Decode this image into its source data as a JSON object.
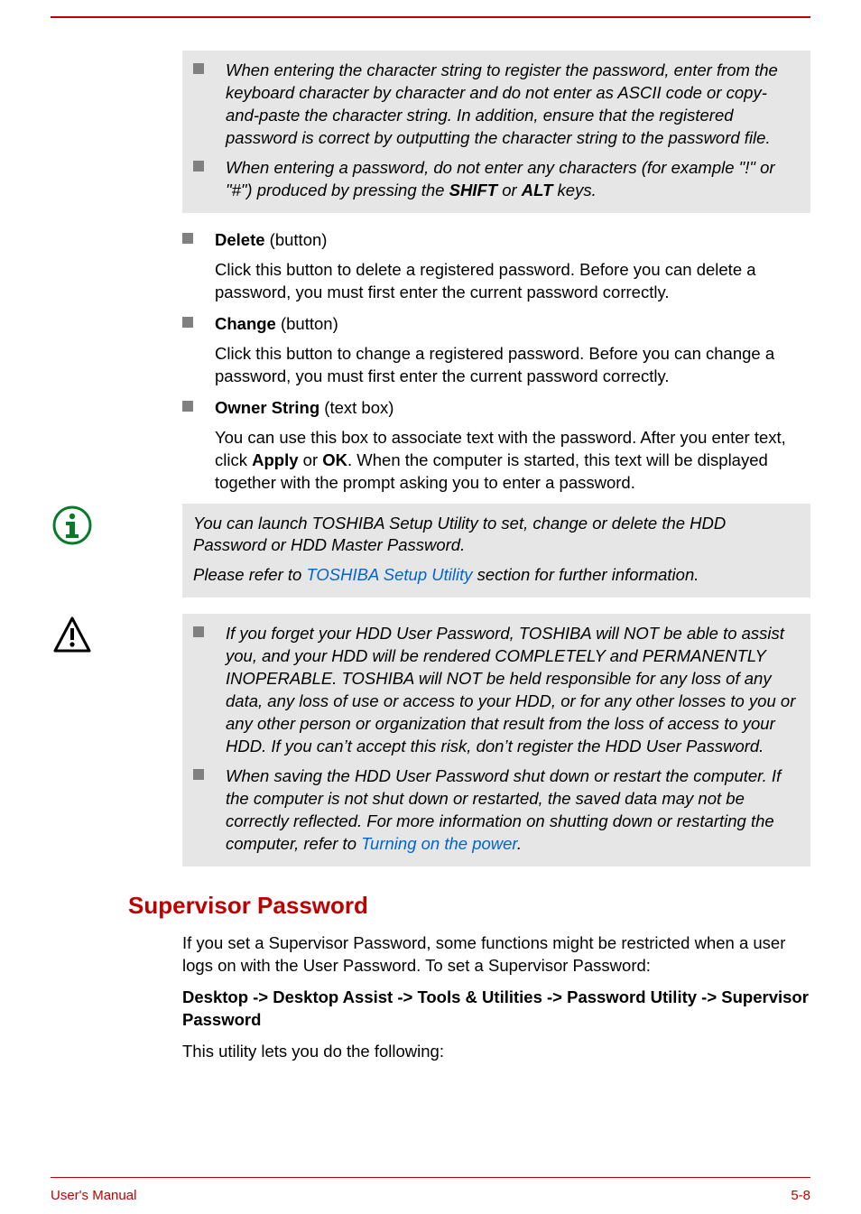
{
  "notes_box1": {
    "items": [
      {
        "pre": "When entering the character string to register the password, enter from the keyboard character by character and do not enter as ASCII code or copy-and-paste the character string. In addition, ensure that the registered password is correct by outputting the character string to the password file."
      },
      {
        "pre": "When entering a password, do not enter any characters (for example \"!\" or \"#\") produced by pressing the ",
        "b1": "SHIFT",
        "mid": " or ",
        "b2": "ALT",
        "post": " keys."
      }
    ]
  },
  "body_items": [
    {
      "label_bold": "Delete",
      "label_rest": " (button)",
      "desc": "Click this button to delete a registered password. Before you can delete a password, you must first enter the current password correctly."
    },
    {
      "label_bold": "Change",
      "label_rest": " (button)",
      "desc": "Click this button to change a registered password. Before you can change a password, you must first enter the current password correctly."
    },
    {
      "label_bold": "Owner String",
      "label_rest": " (text box)",
      "desc_pre": "You can use this box to associate text with the password. After you enter text, click ",
      "desc_b1": "Apply",
      "desc_mid": " or ",
      "desc_b2": "OK",
      "desc_post": ". When the computer is started, this text will be displayed together with the prompt asking you to enter a password."
    }
  ],
  "info_note": {
    "line1": "You can launch TOSHIBA Setup Utility to set, change or delete the HDD Password or HDD Master Password.",
    "line2_pre": "Please refer to ",
    "line2_link": "TOSHIBA Setup Utility",
    "line2_post": " section for further information."
  },
  "warn_box": {
    "items": [
      "If you forget your HDD User Password, TOSHIBA will NOT be able to assist you, and your HDD will be rendered COMPLETELY and PERMANENTLY INOPERABLE. TOSHIBA will NOT be held responsible for any loss of any data, any loss of use or access to your HDD, or for any other losses to you or any other person or organization that result from the loss of access to your HDD. If you can’t accept this risk, don’t register the HDD User Password."
    ],
    "item2_pre": "When saving the HDD User Password shut down or restart the computer. If the computer is not shut down or restarted, the saved data may not be correctly reflected. For more information on shutting down or restarting the computer, refer to ",
    "item2_link": "Turning on the power",
    "item2_post": "."
  },
  "section": {
    "heading": "Supervisor Password",
    "p1": "If you set a Supervisor Password, some functions might be restricted when a user logs on with the User Password. To set a Supervisor Password:",
    "p2": "Desktop -> Desktop Assist -> Tools & Utilities -> Password Utility -> Supervisor Password",
    "p3": "This utility lets you do the following:"
  },
  "footer": {
    "left": "User's Manual",
    "right": "5-8"
  }
}
